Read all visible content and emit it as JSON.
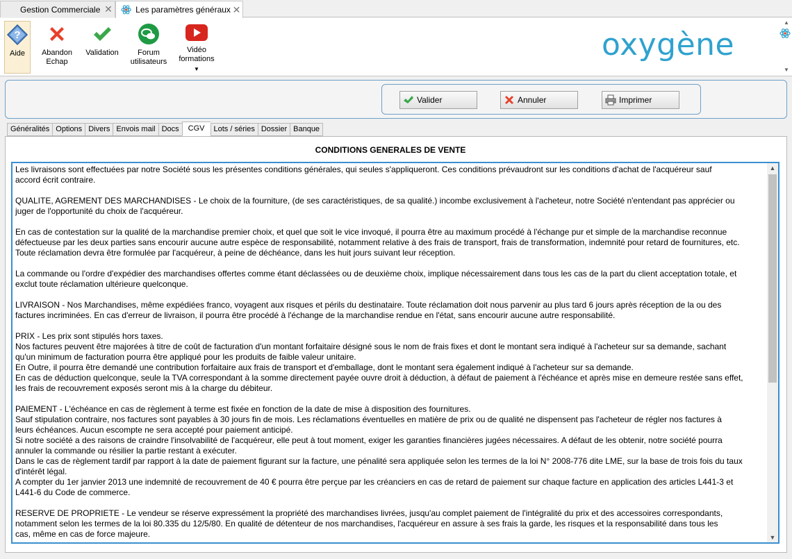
{
  "doc_tabs": [
    {
      "label": "Gestion Commerciale"
    },
    {
      "label": "Les paramètres généraux"
    }
  ],
  "ribbon": {
    "aide": "Aide",
    "abandon_1": "Abandon",
    "abandon_2": "Echap",
    "validation": "Validation",
    "forum_1": "Forum",
    "forum_2": "utilisateurs",
    "video_1": "Vidéo",
    "video_2": "formations",
    "logo": "oxygène"
  },
  "actions": {
    "valider": "Valider",
    "annuler": "Annuler",
    "imprimer": "Imprimer"
  },
  "tabs": [
    "Généralités",
    "Options",
    "Divers",
    "Envois mail",
    "Docs",
    "CGV",
    "Lots / séries",
    "Dossier",
    "Banque"
  ],
  "active_tab": "CGV",
  "cgv": {
    "title": "CONDITIONS GENERALES DE VENTE",
    "paragraphs": [
      "Les livraisons sont effectuées par notre Société sous les présentes conditions générales, qui seules s'appliqueront. Ces conditions prévaudront sur les conditions d'achat de l'acquéreur sauf\naccord écrit contraire.",
      "QUALITE, AGREMENT DES MARCHANDISES - Le choix de la fourniture, (de ses caractéristiques, de sa qualité.) incombe exclusivement à l'acheteur, notre Société n'entendant pas apprécier ou\njuger de l'opportunité du choix de l'acquéreur.",
      "En cas de contestation sur la qualité de la marchandise premier choix, et quel que soit le vice invoqué, il pourra être au maximum procédé à l'échange pur et simple de la marchandise reconnue\ndéfectueuse par les deux parties sans encourir aucune autre espèce de responsabilité, notamment relative à des frais de transport, frais de transformation, indemnité pour retard de fournitures, etc.\nToute réclamation devra être formulée par l'acquéreur, à peine de déchéance, dans les huit jours suivant leur réception.",
      "La commande ou l'ordre d'expédier des marchandises offertes comme étant déclassées ou de deuxième choix, implique nécessairement dans tous les cas de la part du client acceptation totale, et\nexclut toute réclamation ultérieure quelconque.",
      "LIVRAISON - Nos Marchandises, même expédiées franco, voyagent aux risques et périls du destinataire. Toute réclamation doit nous parvenir au plus tard 6 jours après réception de la ou des\nfactures incriminées. En cas d'erreur de livraison, il pourra être procédé à l'échange de la marchandise rendue en l'état, sans encourir aucune autre responsabilité.",
      "PRIX - Les prix sont stipulés hors taxes.\nNos factures peuvent être majorées à titre de coût de facturation d'un montant forfaitaire désigné sous le nom de frais fixes et dont le montant sera indiqué à l'acheteur sur sa demande, sachant\nqu'un minimum de facturation pourra être appliqué pour les produits de faible valeur unitaire.\nEn Outre, il pourra être demandé une contribution forfaitaire aux frais de transport et d'emballage, dont le montant sera également indiqué à l'acheteur sur sa demande.\nEn cas de déduction quelconque, seule la TVA correspondant à la somme directement payée ouvre droit à déduction, à défaut de paiement à l'échéance et après mise en demeure restée sans effet,\nles frais de recouvrement exposés seront mis à la charge du débiteur.",
      "PAIEMENT - L'échéance en cas de règlement à terme est fixée en fonction de la date de mise à disposition des fournitures.\nSauf stipulation contraire, nos factures sont payables à 30 jours fin de mois. Les réclamations éventuelles en matière de prix ou de qualité ne dispensent pas l'acheteur de régler nos factures à\nleurs échéances. Aucun escompte ne sera accepté pour paiement anticipé.\nSi notre société a des raisons de craindre l'insolvabilité de l'acquéreur, elle peut à tout moment, exiger les garanties financières jugées nécessaires. A défaut de les obtenir, notre société pourra\nannuler la commande ou résilier la partie restant à exécuter.\nDans le cas de règlement tardif par rapport à la date de paiement figurant sur la facture, une pénalité sera appliquée selon les termes de la loi N° 2008-776 dite LME, sur la base de trois fois du taux\nd'intérêt légal.\nA compter du 1er janvier 2013 une indemnité de recouvrement de 40 € pourra être perçue par les créanciers en cas de retard de paiement sur chaque facture en application des articles L441-3 et\nL441-6 du Code de commerce.",
      "RESERVE DE PROPRIETE - Le vendeur se réserve expressément la propriété des marchandises livrées, jusqu'au complet paiement de l'intégralité du prix et des accessoires correspondants,\nnotamment selon les termes de la loi 80.335 du 12/5/80. En qualité de détenteur de nos marchandises, l'acquéreur en assure à ses frais la garde, les risques et la responsabilité dans tous les\ncas, même en cas de force majeure."
    ]
  },
  "colors": {
    "accent": "#3a8fd0",
    "logo": "#2fa2cf",
    "abandon_red": "#e8402a",
    "valid_green": "#3aa84a",
    "forum_green": "#1f9a44",
    "video_red": "#d7261e"
  }
}
